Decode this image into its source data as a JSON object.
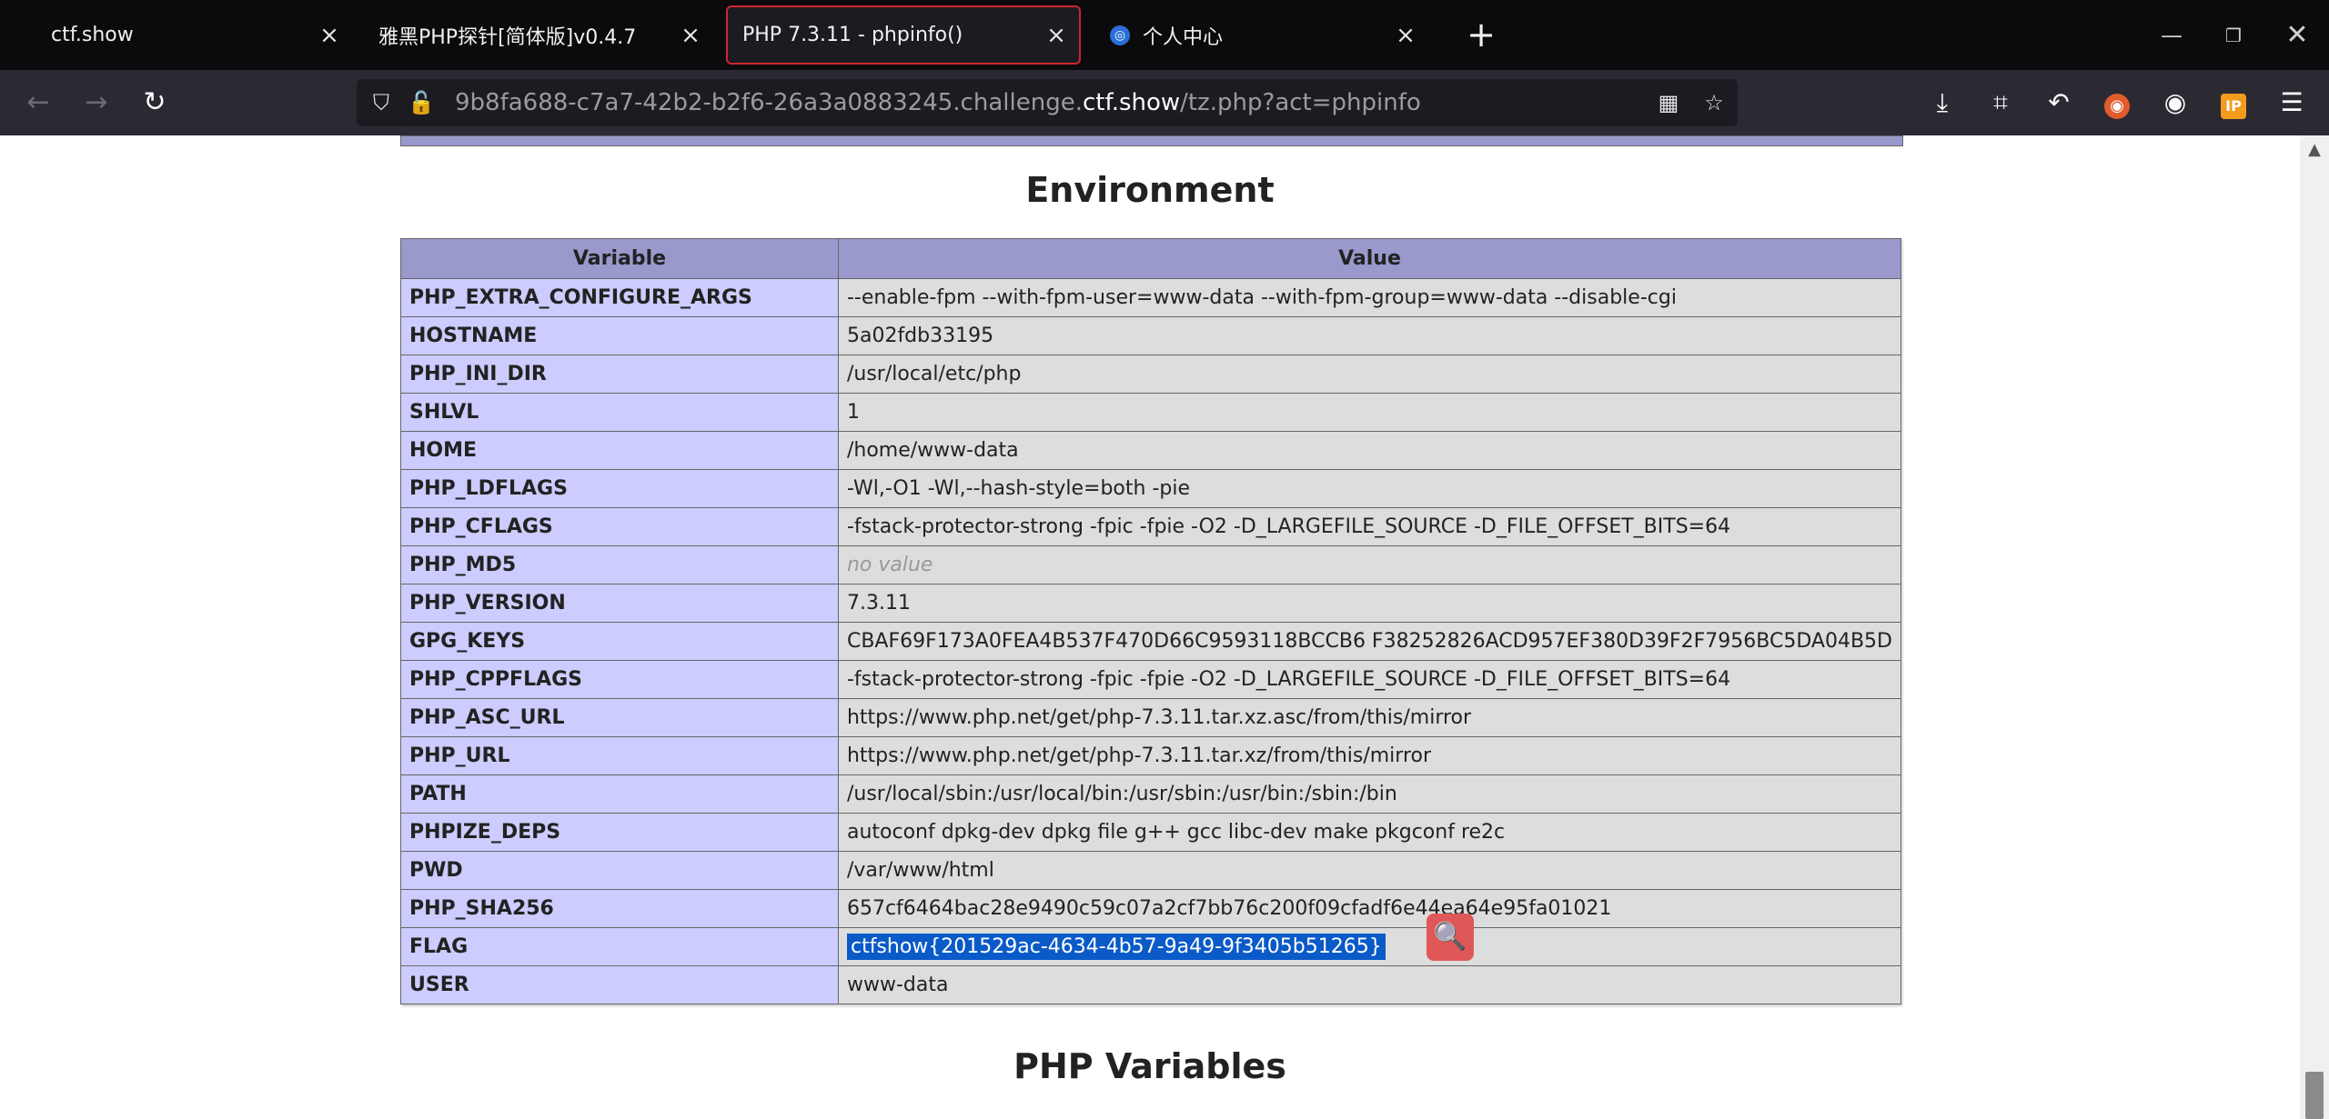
{
  "tabs": [
    {
      "title": "ctf.show"
    },
    {
      "title": "雅黑PHP探针[简体版]v0.4.7"
    },
    {
      "title": "PHP 7.3.11 - phpinfo()"
    },
    {
      "title": "个人中心"
    }
  ],
  "url": {
    "prefix": "9b8fa688-c7a7-42b2-b2f6-26a3a0883245.challenge.",
    "domain": "ctf.show",
    "path": "/tz.php?act=phpinfo"
  },
  "page": {
    "section_title": "Environment",
    "next_section_title": "PHP Variables",
    "table": {
      "headers": [
        "Variable",
        "Value"
      ],
      "rows": [
        {
          "name": "PHP_EXTRA_CONFIGURE_ARGS",
          "value": "--enable-fpm --with-fpm-user=www-data --with-fpm-group=www-data --disable-cgi"
        },
        {
          "name": "HOSTNAME",
          "value": "5a02fdb33195"
        },
        {
          "name": "PHP_INI_DIR",
          "value": "/usr/local/etc/php"
        },
        {
          "name": "SHLVL",
          "value": "1"
        },
        {
          "name": "HOME",
          "value": "/home/www-data"
        },
        {
          "name": "PHP_LDFLAGS",
          "value": "-Wl,-O1 -Wl,--hash-style=both -pie"
        },
        {
          "name": "PHP_CFLAGS",
          "value": "-fstack-protector-strong -fpic -fpie -O2 -D_LARGEFILE_SOURCE -D_FILE_OFFSET_BITS=64"
        },
        {
          "name": "PHP_MD5",
          "value": "no value"
        },
        {
          "name": "PHP_VERSION",
          "value": "7.3.11"
        },
        {
          "name": "GPG_KEYS",
          "value": "CBAF69F173A0FEA4B537F470D66C9593118BCCB6 F38252826ACD957EF380D39F2F7956BC5DA04B5D"
        },
        {
          "name": "PHP_CPPFLAGS",
          "value": "-fstack-protector-strong -fpic -fpie -O2 -D_LARGEFILE_SOURCE -D_FILE_OFFSET_BITS=64"
        },
        {
          "name": "PHP_ASC_URL",
          "value": "https://www.php.net/get/php-7.3.11.tar.xz.asc/from/this/mirror"
        },
        {
          "name": "PHP_URL",
          "value": "https://www.php.net/get/php-7.3.11.tar.xz/from/this/mirror"
        },
        {
          "name": "PATH",
          "value": "/usr/local/sbin:/usr/local/bin:/usr/sbin:/usr/bin:/sbin:/bin"
        },
        {
          "name": "PHPIZE_DEPS",
          "value": "autoconf dpkg-dev dpkg file g++ gcc libc-dev make pkgconf re2c"
        },
        {
          "name": "PWD",
          "value": "/var/www/html"
        },
        {
          "name": "PHP_SHA256",
          "value": "657cf6464bac28e9490c59c07a2cf7bb76c200f09cfadf6e44ea64e95fa01021"
        },
        {
          "name": "FLAG",
          "value": "ctfshow{201529ac-4634-4b57-9a49-9f3405b51265}"
        },
        {
          "name": "USER",
          "value": "www-data"
        }
      ]
    }
  },
  "icons": {
    "close": "close-icon",
    "new_tab": "plus-icon",
    "back": "back-arrow-icon",
    "forward": "forward-arrow-icon",
    "reload": "reload-icon",
    "shield": "shield-icon",
    "insecure": "insecure-lock-icon",
    "qr": "qr-code-icon",
    "bookmark": "star-icon",
    "download": "download-icon",
    "screenshot": "crop-icon",
    "undo": "undo-icon",
    "menu": "hamburger-menu-icon"
  }
}
